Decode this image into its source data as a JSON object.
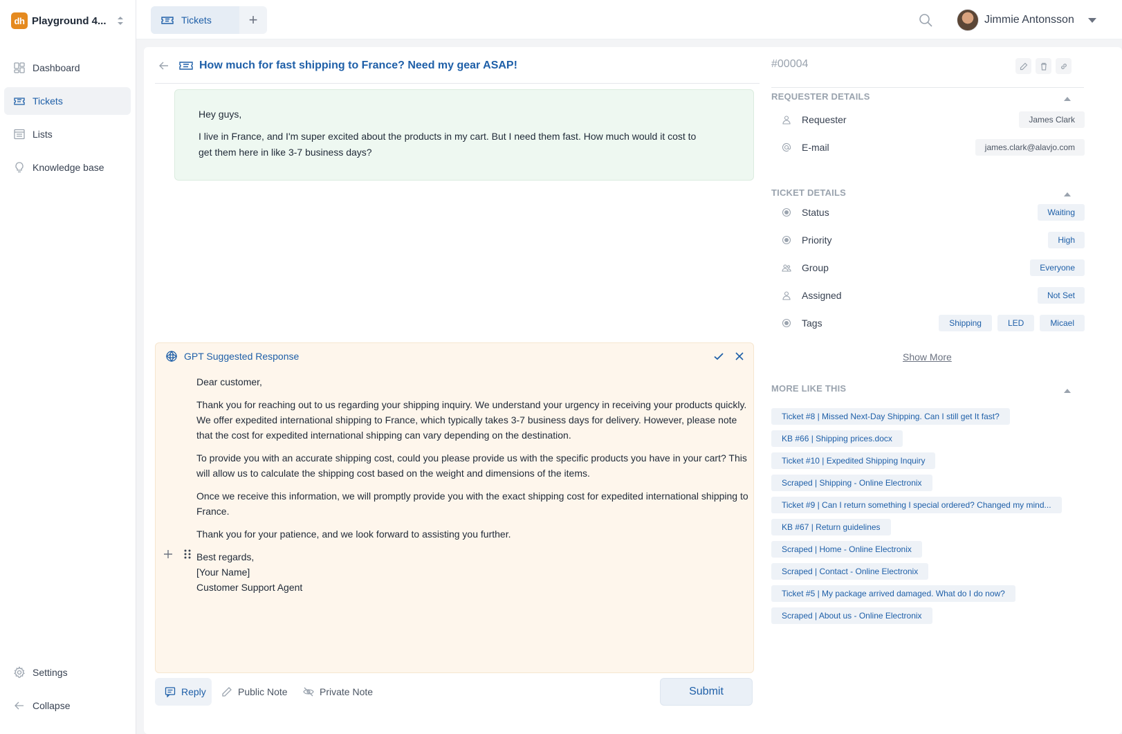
{
  "brand": {
    "logo_text": "dh",
    "name": "Playground 4..."
  },
  "sidebar": {
    "items": [
      {
        "label": "Dashboard",
        "icon": "dashboard-icon"
      },
      {
        "label": "Tickets",
        "icon": "ticket-icon",
        "active": true
      },
      {
        "label": "Lists",
        "icon": "list-icon"
      },
      {
        "label": "Knowledge base",
        "icon": "lightbulb-icon"
      }
    ],
    "bottom": [
      {
        "label": "Settings",
        "icon": "gear-icon"
      },
      {
        "label": "Collapse",
        "icon": "arrow-left-icon"
      }
    ]
  },
  "topbar": {
    "tab_label": "Tickets",
    "add_tab": "+",
    "user_name": "Jimmie Antonsson"
  },
  "ticket": {
    "title": "How much for fast shipping to France? Need my gear ASAP!",
    "number": "#00004"
  },
  "message": {
    "greeting": "Hey guys,",
    "body": "I live in France, and I'm super excited about the products in my cart. But I need them fast. How much would it cost to get them here in like 3-7 business days?"
  },
  "gpt": {
    "heading": "GPT Suggested Response",
    "paragraphs": [
      "Dear customer,",
      "Thank you for reaching out to us regarding your shipping inquiry. We understand your urgency in receiving your products quickly. We offer expedited international shipping to France, which typically takes 3-7 business days for delivery. However, please note that the cost for expedited international shipping can vary depending on the destination.",
      "To provide you with an accurate shipping cost, could you please provide us with the specific products you have in your cart? This will allow us to calculate the shipping cost based on the weight and dimensions of the items.",
      "Once we receive this information, we will promptly provide you with the exact shipping cost for expedited international shipping to France.",
      "Thank you for your patience, and we look forward to assisting you further."
    ],
    "signoff": [
      "Best regards,",
      "[Your Name]",
      "Customer Support Agent"
    ]
  },
  "reply_bar": {
    "reply": "Reply",
    "public_note": "Public Note",
    "private_note": "Private Note",
    "submit": "Submit"
  },
  "requester_details": {
    "title": "REQUESTER DETAILS",
    "requester_label": "Requester",
    "requester_value": "James Clark",
    "email_label": "E-mail",
    "email_value": "james.clark@alavjo.com"
  },
  "ticket_details": {
    "title": "TICKET DETAILS",
    "status_label": "Status",
    "status_value": "Waiting",
    "priority_label": "Priority",
    "priority_value": "High",
    "group_label": "Group",
    "group_value": "Everyone",
    "assigned_label": "Assigned",
    "assigned_value": "Not Set",
    "tags_label": "Tags",
    "tags": [
      "Shipping",
      "LED",
      "Micael"
    ],
    "show_more": "Show More"
  },
  "more_like_this": {
    "title": "MORE LIKE THIS",
    "items": [
      "Ticket #8 | Missed Next-Day Shipping. Can I still get It fast?",
      "KB #66 | Shipping prices.docx",
      "Ticket #10 | Expedited Shipping Inquiry",
      "Scraped | Shipping - Online Electronix",
      "Ticket #9 | Can I return something I special ordered? Changed my mind...",
      "KB #67 | Return guidelines",
      "Scraped | Home - Online Electronix",
      "Scraped | Contact - Online Electronix",
      "Ticket #5 | My package arrived damaged. What do I do now?",
      "Scraped | About us - Online Electronix"
    ]
  },
  "colors": {
    "accent": "#1e5fa8",
    "brand": "#e58a1f",
    "message_bg": "#eef8f1",
    "gpt_bg": "#fef6ec"
  }
}
